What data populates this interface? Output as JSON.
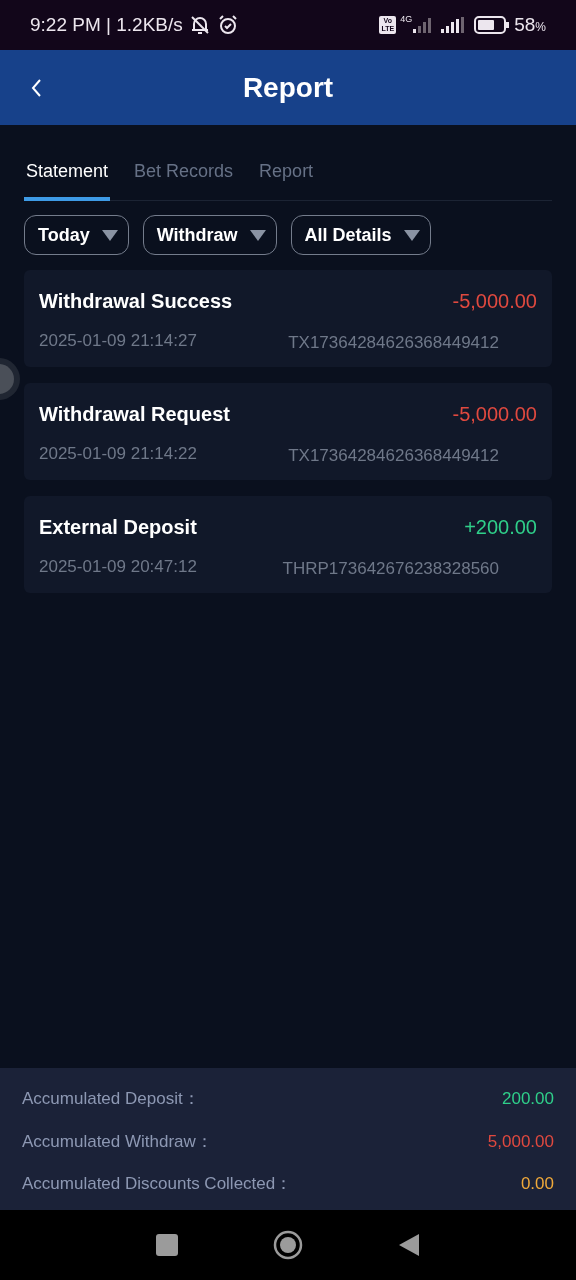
{
  "status_bar": {
    "time": "9:22 PM | 1.2KB/s",
    "battery": "58",
    "battery_unit": "%",
    "volte": "Vo\nLTE",
    "network": "4G"
  },
  "header": {
    "title": "Report"
  },
  "tabs": [
    {
      "label": "Statement",
      "selected": true
    },
    {
      "label": "Bet Records",
      "selected": false
    },
    {
      "label": "Report",
      "selected": false
    }
  ],
  "filters": [
    {
      "label": "Today"
    },
    {
      "label": "Withdraw"
    },
    {
      "label": "All Details"
    }
  ],
  "transactions": [
    {
      "title": "Withdrawal Success",
      "amount": "-5,000.00",
      "color": "#e0493f",
      "time": "2025-01-09 21:14:27",
      "reference": "TX17364284626368449412"
    },
    {
      "title": "Withdrawal Request",
      "amount": "-5,000.00",
      "color": "#e0493f",
      "time": "2025-01-09 21:14:22",
      "reference": "TX17364284626368449412"
    },
    {
      "title": "External Deposit",
      "amount": "+200.00",
      "color": "#2fcf8a",
      "time": "2025-01-09 20:47:12",
      "reference": "THRP173642676238328560"
    }
  ],
  "summary": [
    {
      "label": "Accumulated Deposit：",
      "value": "200.00",
      "color": "#2fcf8a"
    },
    {
      "label": "Accumulated Withdraw：",
      "value": "5,000.00",
      "color": "#e0493f"
    },
    {
      "label": "Accumulated Discounts Collected：",
      "value": "0.00",
      "color": "#f0a93a"
    }
  ]
}
